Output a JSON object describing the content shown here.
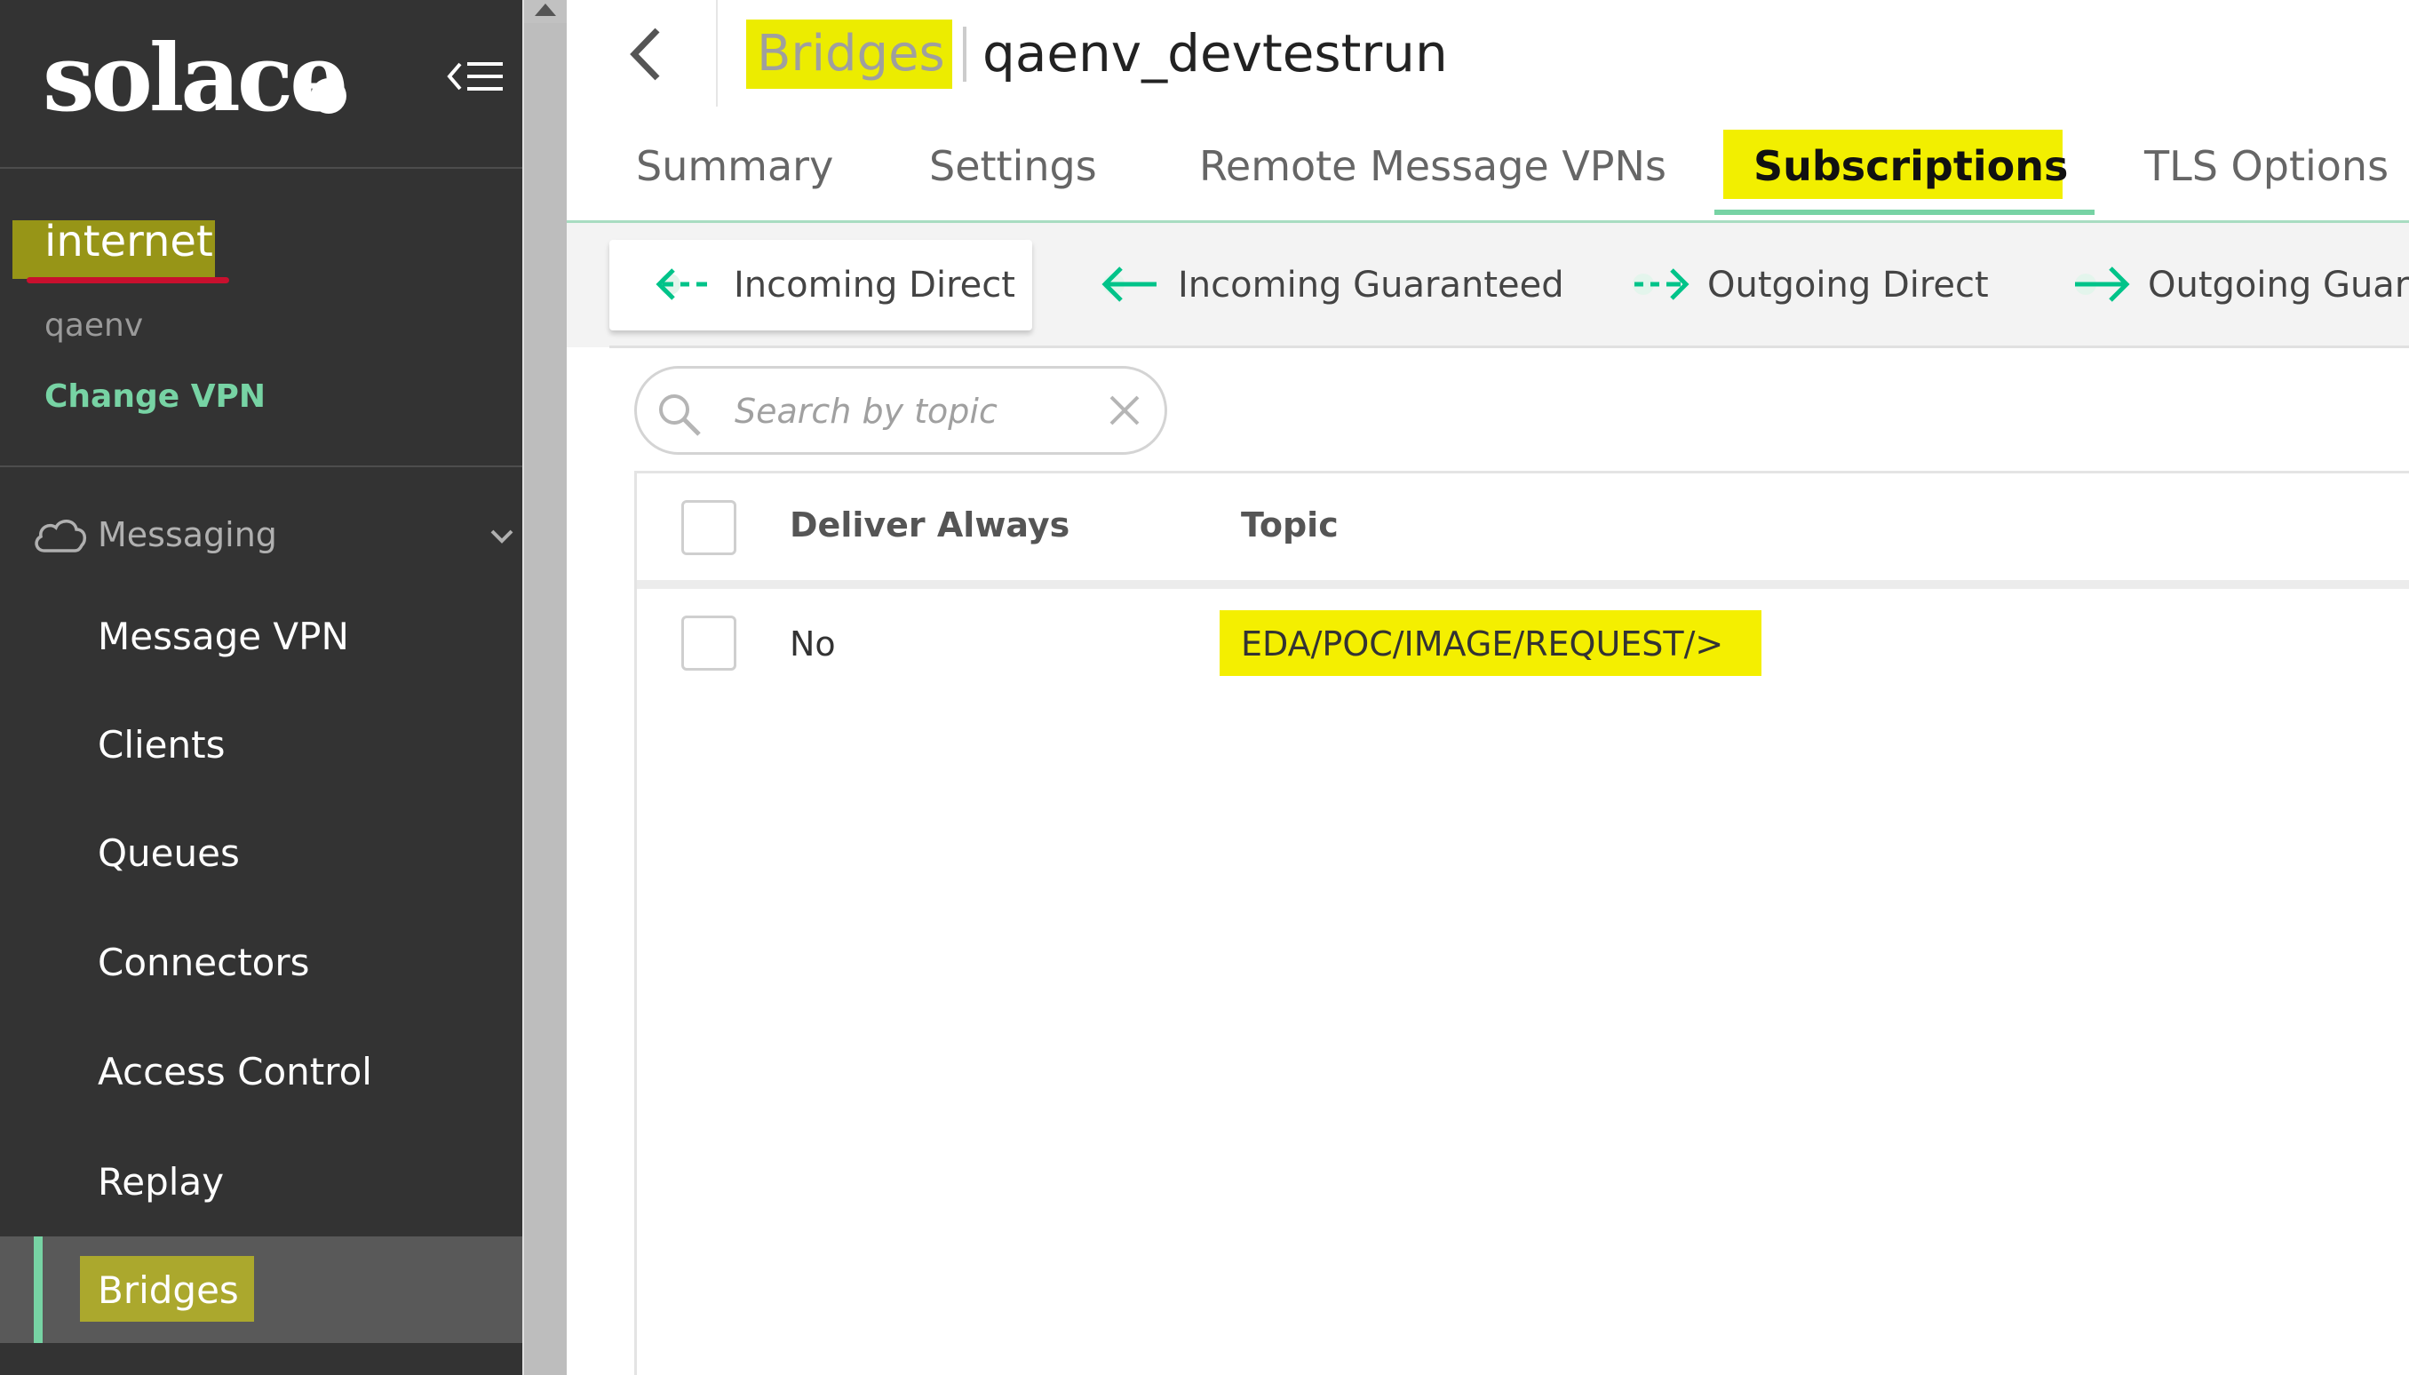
{
  "brand": {
    "logo_text": "solace"
  },
  "sidebar": {
    "vpn_name": "internet",
    "vpn_sub": "qaenv",
    "change_vpn": "Change VPN",
    "section_label": "Messaging",
    "items": [
      {
        "label": "Message VPN"
      },
      {
        "label": "Clients"
      },
      {
        "label": "Queues"
      },
      {
        "label": "Connectors"
      },
      {
        "label": "Access Control"
      },
      {
        "label": "Replay"
      },
      {
        "label": "Bridges",
        "active": true
      }
    ]
  },
  "header": {
    "breadcrumb_parent": "Bridges",
    "title": "qaenv_devtestrun"
  },
  "tabs": [
    {
      "label": "Summary"
    },
    {
      "label": "Settings"
    },
    {
      "label": "Remote Message VPNs"
    },
    {
      "label": "Subscriptions",
      "active": true
    },
    {
      "label": "TLS Options"
    }
  ],
  "subtabs": [
    {
      "label": "Incoming Direct",
      "icon": "incoming-direct-icon",
      "active": true
    },
    {
      "label": "Incoming Guaranteed",
      "icon": "incoming-guaranteed-icon"
    },
    {
      "label": "Outgoing Direct",
      "icon": "outgoing-direct-icon"
    },
    {
      "label": "Outgoing Guaranteed",
      "icon": "outgoing-guaranteed-icon"
    }
  ],
  "search": {
    "placeholder": "Search by topic",
    "value": ""
  },
  "table": {
    "columns": [
      "Deliver Always",
      "Topic"
    ],
    "rows": [
      {
        "deliver_always": "No",
        "topic": "EDA/POC/IMAGE/REQUEST/>"
      }
    ]
  },
  "colors": {
    "sidebar_bg": "#333333",
    "accent_green": "#77d3a4",
    "arrow_green": "#00c389",
    "highlight_yellow": "#f2ef00",
    "underline_red": "#c8102e"
  }
}
